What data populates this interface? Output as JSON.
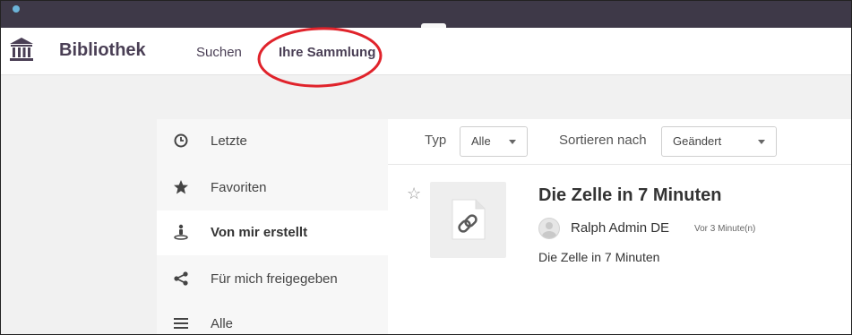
{
  "header": {
    "brand": "Bibliothek",
    "nav": [
      {
        "label": "Suchen"
      },
      {
        "label": "Ihre Sammlung",
        "active": true
      }
    ],
    "annotation_color": "#e0232b"
  },
  "sidebar": {
    "items": [
      {
        "label": "Letzte",
        "icon": "clock-icon",
        "active": false
      },
      {
        "label": "Favoriten",
        "icon": "star-icon",
        "active": false
      },
      {
        "label": "Von mir erstellt",
        "icon": "user-pin-icon",
        "active": true
      },
      {
        "label": "Für mich freigegeben",
        "icon": "share-icon",
        "active": false
      },
      {
        "label": "Alle",
        "icon": "list-icon",
        "active": false
      }
    ]
  },
  "filters": {
    "type_label": "Typ",
    "type_value": "Alle",
    "sort_label": "Sortieren nach",
    "sort_value": "Geändert"
  },
  "items": [
    {
      "title": "Die Zelle in 7 Minuten",
      "author": "Ralph Admin DE",
      "time": "Vor 3 Minute(n)",
      "description": "Die Zelle in 7 Minuten",
      "icon": "link-document-icon"
    }
  ],
  "colors": {
    "topbar": "#3e3948",
    "brand": "#4a3f55"
  }
}
